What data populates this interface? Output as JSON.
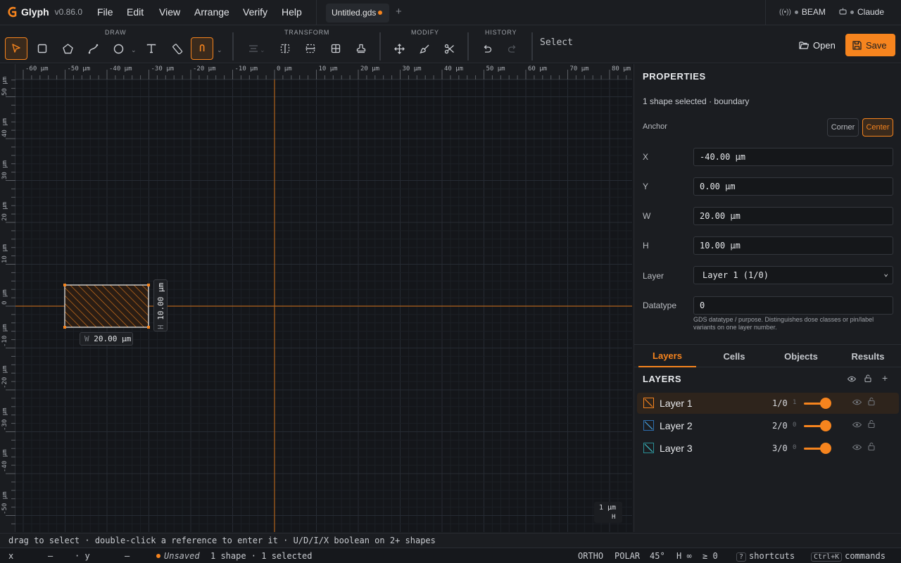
{
  "app": {
    "name": "Glyph",
    "version": "v0.86.0"
  },
  "menu": [
    "File",
    "Edit",
    "View",
    "Arrange",
    "Verify",
    "Help"
  ],
  "document_tab": {
    "title": "Untitled.gds",
    "unsaved": true
  },
  "integrations": {
    "beam": "BEAM",
    "assistant": "Claude"
  },
  "toolbar": {
    "groups": {
      "draw": "DRAW",
      "transform": "TRANSFORM",
      "modify": "MODIFY",
      "history": "HISTORY"
    },
    "active_tool_label": "Select",
    "open_label": "Open",
    "save_label": "Save"
  },
  "rulers": {
    "x_labels": [
      "-60 µm",
      "-50 µm",
      "-40 µm",
      "-30 µm",
      "-20 µm",
      "-10 µm",
      "0 µm",
      "10 µm",
      "20 µm",
      "30 µm",
      "40 µm",
      "50 µm",
      "60 µm",
      "70 µm",
      "80 µm"
    ],
    "y_labels": [
      "50 µm",
      "40 µm",
      "30 µm",
      "20 µm",
      "10 µm",
      "0 µm",
      "-10 µm",
      "-20 µm",
      "-30 µm",
      "-40 µm",
      "-50 µm"
    ]
  },
  "canvas": {
    "width_tag": {
      "prefix": "W",
      "value": "20.00 µm"
    },
    "height_tag": {
      "prefix": "H",
      "value": "10.00 µm"
    },
    "scale": {
      "value": "1 µm",
      "suffix": "H"
    }
  },
  "properties": {
    "title": "PROPERTIES",
    "selection": "1 shape selected · boundary",
    "anchor_label": "Anchor",
    "anchor_options": [
      "Corner",
      "Center"
    ],
    "anchor_selected": "Center",
    "fields": {
      "x": {
        "label": "X",
        "value": "-40.00 µm"
      },
      "y": {
        "label": "Y",
        "value": "0.00 µm"
      },
      "w": {
        "label": "W",
        "value": "20.00 µm"
      },
      "h": {
        "label": "H",
        "value": "10.00 µm"
      },
      "layer": {
        "label": "Layer",
        "value": "Layer 1 (1/0)"
      },
      "datatype": {
        "label": "Datatype",
        "value": "0",
        "hint": "GDS datatype / purpose. Distinguishes dose classes or pin/label variants on one layer number."
      }
    }
  },
  "panel_tabs": [
    "Layers",
    "Cells",
    "Objects",
    "Results"
  ],
  "layers_panel": {
    "title": "LAYERS",
    "layers": [
      {
        "name": "Layer 1",
        "num": "1/0",
        "small": "1",
        "color": "#f6841e",
        "selected": true
      },
      {
        "name": "Layer 2",
        "num": "2/0",
        "small": "0",
        "color": "#4aa3df",
        "selected": false
      },
      {
        "name": "Layer 3",
        "num": "3/0",
        "small": "0",
        "color": "#3fc1c9",
        "selected": false
      }
    ]
  },
  "hint_bar": "drag to select · double-click a reference to enter it · U/D/I/X boolean on 2+ shapes",
  "status": {
    "x_label": "x",
    "x_value": "—",
    "y_label": "· y",
    "y_value": "—",
    "save_state": "Unsaved",
    "selection": "1 shape · 1 selected",
    "ortho": "ORTHO",
    "polar": "POLAR",
    "angle": "45°",
    "h": "H ∞",
    "ge": "≥ 0",
    "shortcuts_key": "?",
    "shortcuts": "shortcuts",
    "commands_key": "Ctrl+K",
    "commands": "commands"
  }
}
